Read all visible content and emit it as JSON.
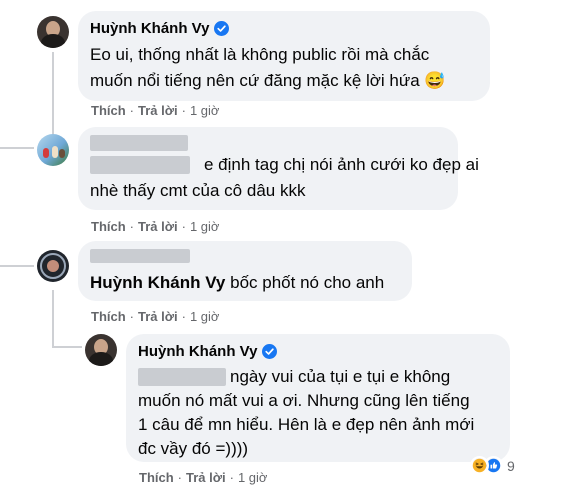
{
  "comments": [
    {
      "author": "Huỳnh Khánh Vy",
      "lines": [
        "Eo ui, thống nhất là không public rồi mà chắc",
        "muốn nổi tiếng nên cứ đăng mặc kệ lời hứa 😅"
      ],
      "actions": {
        "like": "Thích",
        "reply": "Trả lời",
        "time": "1 giờ"
      }
    },
    {
      "line1_text": "e định tag chị nói ảnh cưới ko đẹp ai",
      "line2_text": "nhè thấy cmt của cô dâu kkk",
      "actions": {
        "like": "Thích",
        "reply": "Trả lời",
        "time": "1 giờ"
      }
    },
    {
      "line_author": "Huỳnh Khánh Vy",
      "line_text": "bốc phốt nó cho anh",
      "actions": {
        "like": "Thích",
        "reply": "Trả lời",
        "time": "1 giờ"
      }
    },
    {
      "author": "Huỳnh Khánh Vy",
      "line1_text": "ngày vui của tụi e tụi e không",
      "lines": [
        "muốn nó mất vui a ơi. Nhưng cũng lên tiếng",
        "1 câu để mn hiểu. Hên là e đẹp nên ảnh mới",
        "đc vầy đó =))))"
      ],
      "actions": {
        "like": "Thích",
        "reply": "Trả lời",
        "time": "1 giờ"
      },
      "reaction_count": "9"
    }
  ],
  "separator": "·",
  "colors": {
    "bubble": "#f0f2f5",
    "meta": "#65676b",
    "verified": "#1877f2",
    "thread": "#ced0d4"
  },
  "icons": [
    "verified-badge-icon",
    "haha-reaction-icon",
    "like-reaction-icon"
  ]
}
